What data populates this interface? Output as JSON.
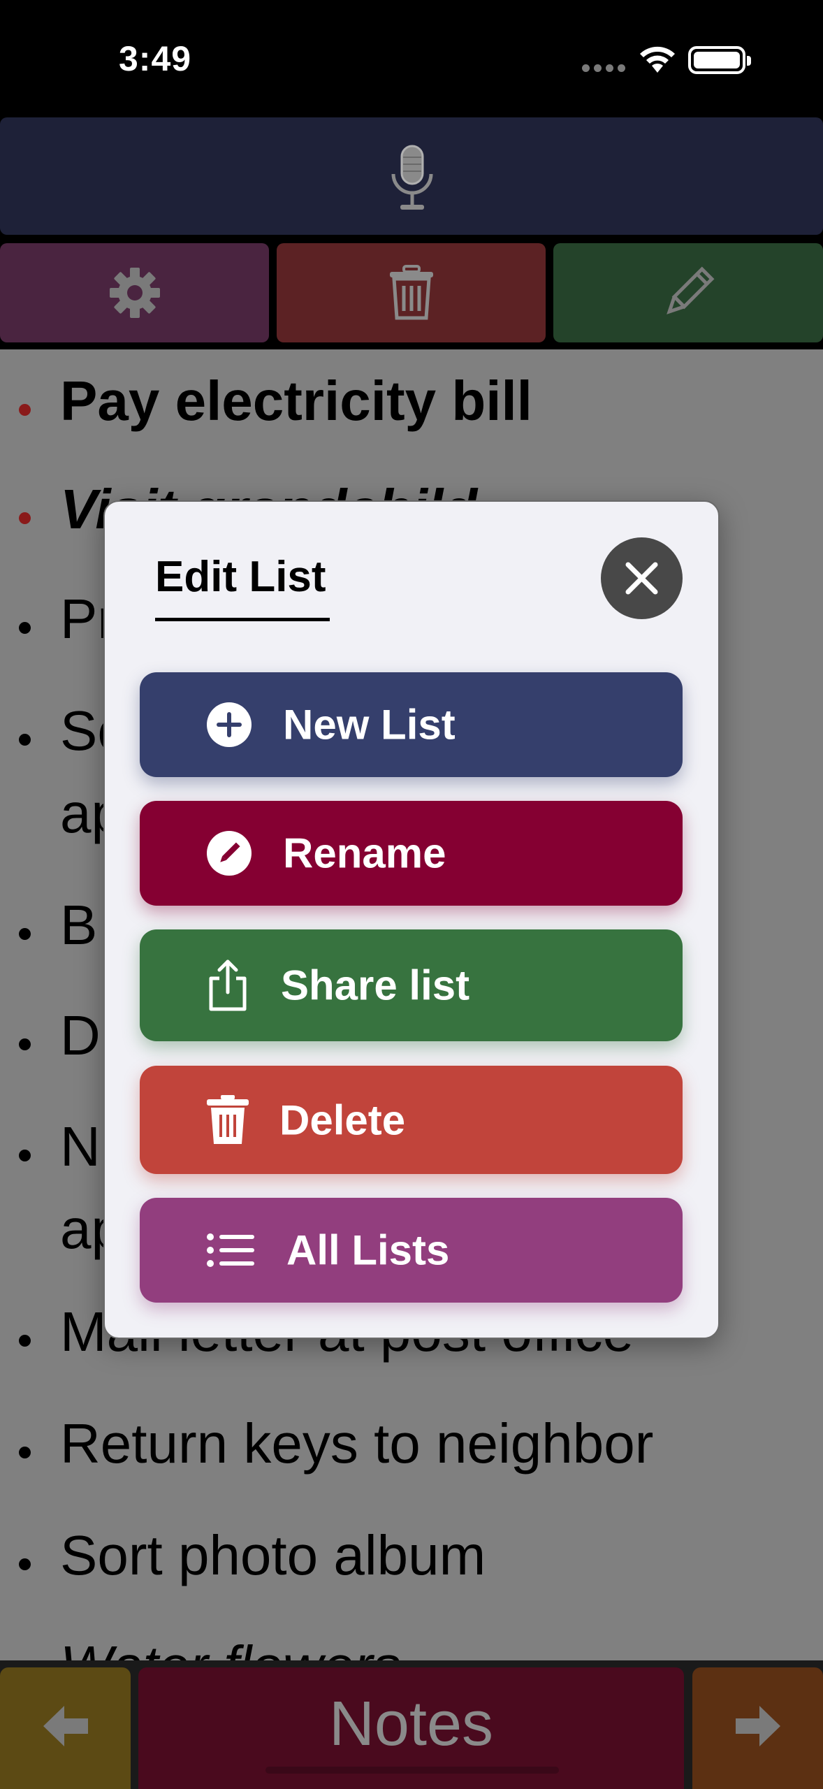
{
  "status_bar": {
    "time": "3:49"
  },
  "list": {
    "items": [
      {
        "text": "Pay electricity bill",
        "style": "bold",
        "bullet": "red"
      },
      {
        "text": "Visit grandchild",
        "style": "bold-italic",
        "bullet": "red"
      },
      {
        "text": "Pr",
        "style": "normal",
        "bullet": "black"
      },
      {
        "text": "Sc",
        "style": "normal",
        "bullet": "black"
      },
      {
        "text": "ap",
        "style": "continuation",
        "bullet": "none"
      },
      {
        "text": "B",
        "style": "normal",
        "bullet": "black"
      },
      {
        "text": "D",
        "style": "normal",
        "bullet": "black"
      },
      {
        "text": "N",
        "style": "normal",
        "bullet": "black"
      },
      {
        "text": "ap",
        "style": "continuation",
        "bullet": "none"
      },
      {
        "text": "Mail letter at post office",
        "style": "normal",
        "bullet": "black"
      },
      {
        "text": "Return keys to neighbor",
        "style": "normal",
        "bullet": "black"
      },
      {
        "text": "Sort photo album",
        "style": "normal",
        "bullet": "black"
      },
      {
        "text": "Water flowers",
        "style": "italic",
        "bullet": "black"
      }
    ]
  },
  "modal": {
    "title": "Edit List",
    "buttons": {
      "new_list": "New List",
      "rename": "Rename",
      "share": "Share list",
      "delete": "Delete",
      "all_lists": "All Lists"
    }
  },
  "bottom_bar": {
    "notes_label": "Notes"
  },
  "icons": {
    "mic": "microphone-icon",
    "settings": "gear-icon",
    "trash": "trash-icon",
    "edit": "pencil-icon",
    "close": "close-icon",
    "prev": "arrow-left-icon",
    "next": "arrow-right-icon"
  },
  "colors": {
    "mic_bar": "#1e2138",
    "settings": "#4a2440",
    "trash": "#5c2224",
    "edit": "#24432a",
    "new_list": "#353f6c",
    "rename": "#850032",
    "share": "#37733f",
    "delete": "#c1443b",
    "all_lists": "#923e7e",
    "notes": "#4a0a1e"
  }
}
